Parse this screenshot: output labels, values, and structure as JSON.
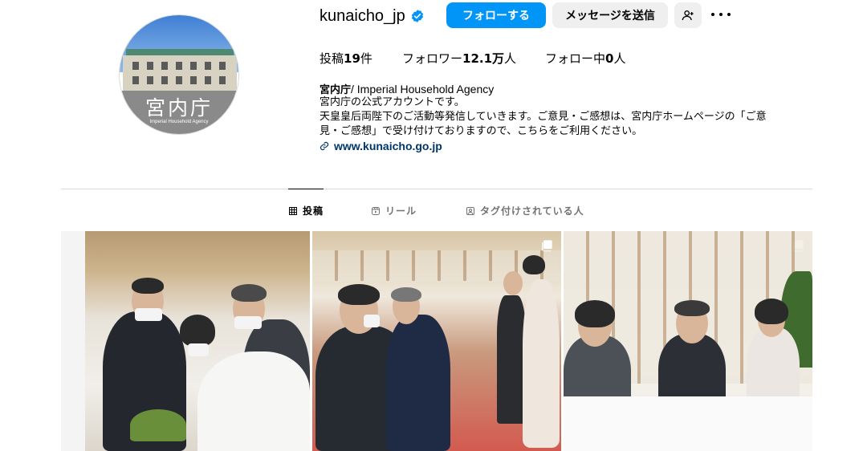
{
  "profile": {
    "username": "kunaicho_jp",
    "verified": true,
    "avatar_title": "宮内庁",
    "avatar_subtitle": "Imperial Household Agency"
  },
  "actions": {
    "follow_label": "フォローする",
    "message_label": "メッセージを送信",
    "suggest_icon": "person-plus-icon",
    "more_icon": "more-horizontal-icon"
  },
  "stats": {
    "posts_label": "投稿",
    "posts_value": "19",
    "posts_suffix": "件",
    "followers_label": "フォロワー",
    "followers_value": "12.1万",
    "followers_suffix": "人",
    "following_label": "フォロー中",
    "following_value": "0",
    "following_suffix": "人"
  },
  "bio": {
    "name_jp": "宮内庁",
    "name_en": "/ Imperial Household Agency",
    "line1": "宮内庁の公式アカウントです。",
    "line2": "天皇皇后両陛下のご活動等発信していきます。ご意見・ご感想は、宮内庁ホームページの「ご意",
    "line3": "見・ご感想」で受け付けておりますので、こちらをご利用ください。",
    "link": "www.kunaicho.go.jp"
  },
  "tabs": [
    {
      "label": "投稿",
      "icon": "grid-icon",
      "active": true
    },
    {
      "label": "リール",
      "icon": "reels-icon",
      "active": false
    },
    {
      "label": "タグ付けされている人",
      "icon": "tagged-icon",
      "active": false
    }
  ],
  "colors": {
    "accent": "#0095f6",
    "button_gray": "#efefef",
    "link": "#00376b",
    "divider": "#dbdbdb"
  }
}
